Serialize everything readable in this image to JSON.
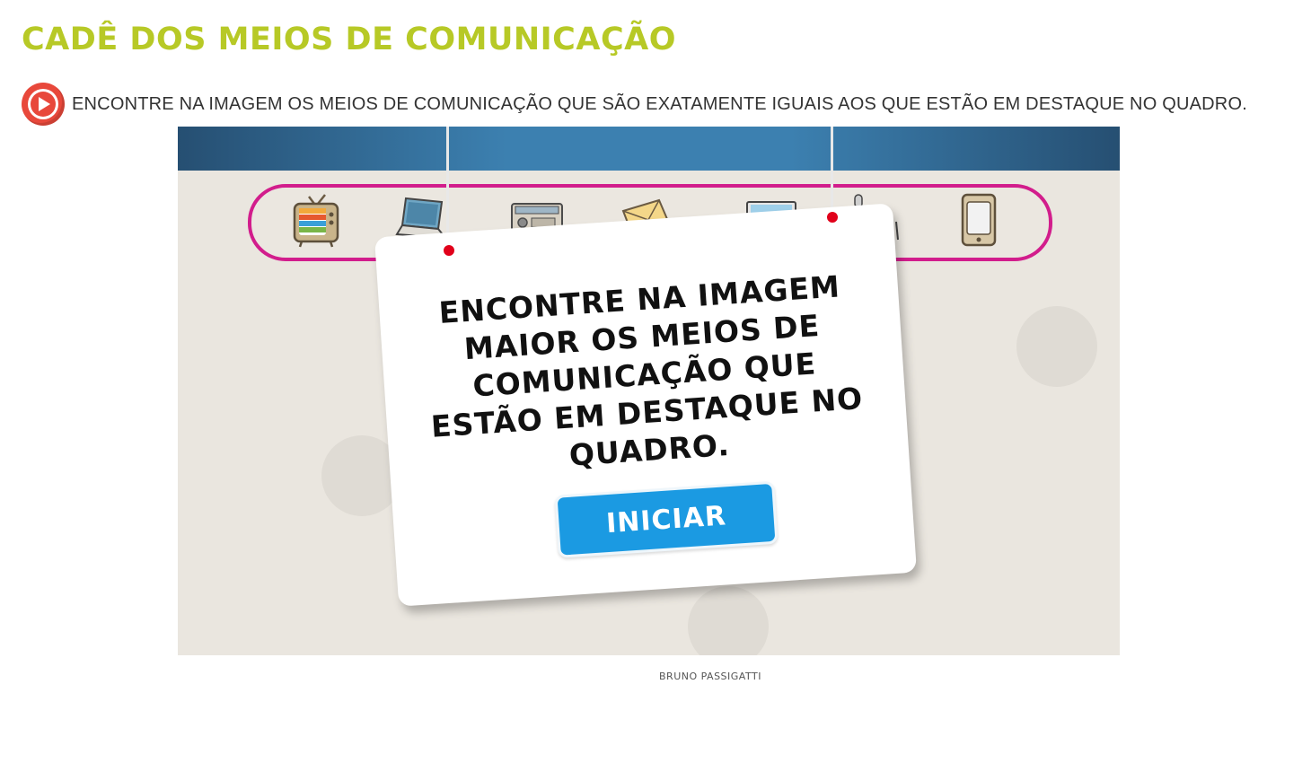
{
  "page": {
    "title": "CADÊ DOS MEIOS DE COMUNICAÇÃO",
    "instruction": "ENCONTRE NA IMAGEM OS MEIOS DE COMUNICAÇÃO QUE SÃO EXATAMENTE IGUAIS AOS QUE ESTÃO EM DESTAQUE NO QUADRO.",
    "credit": "BRUNO PASSIGATTI"
  },
  "play_button": {
    "icon": "play-icon"
  },
  "game": {
    "sign_text": "ENCONTRE NA IMAGEM MAIOR OS MEIOS DE COMUNICAÇÃO QUE ESTÃO EM DESTAQUE NO QUADRO.",
    "start_label": "INICIAR",
    "bar_items": [
      {
        "icon": "television-icon"
      },
      {
        "icon": "laptop-icon"
      },
      {
        "icon": "radio-icon"
      },
      {
        "icon": "letter-icon"
      },
      {
        "icon": "monitor-icon"
      },
      {
        "icon": "microphone-icon"
      },
      {
        "icon": "smartphone-icon"
      }
    ]
  },
  "colors": {
    "title": "#b7c926",
    "play_button": "#e8483b",
    "item_bar_border": "#d21d8c",
    "start_button": "#1b9ae2",
    "game_background": "#eae6df",
    "game_header": "#3c80b0"
  }
}
